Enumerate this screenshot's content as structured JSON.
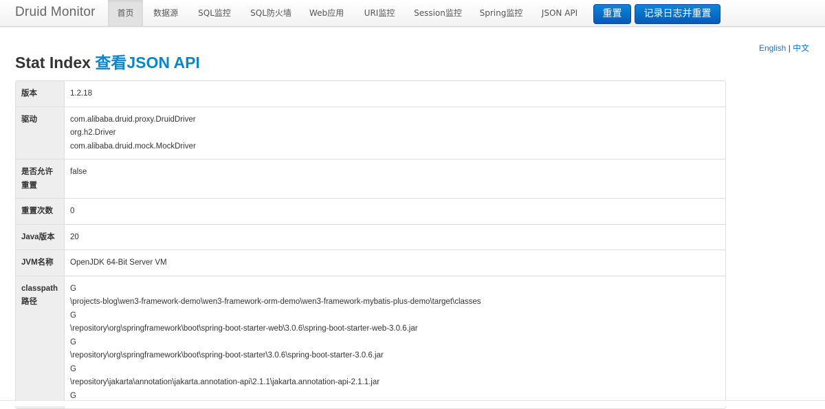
{
  "navbar": {
    "brand": "Druid Monitor",
    "items": [
      {
        "label": "首页",
        "active": true
      },
      {
        "label": "数据源"
      },
      {
        "label": "SQL监控"
      },
      {
        "label": "SQL防火墙"
      },
      {
        "label": "Web应用"
      },
      {
        "label": "URI监控"
      },
      {
        "label": "Session监控"
      },
      {
        "label": "Spring监控"
      },
      {
        "label": "JSON API"
      }
    ],
    "reset_button": "重置",
    "log_reset_button": "记录日志并重置",
    "button_color": "#0a6fcd"
  },
  "lang": {
    "english": "English",
    "separator": "|",
    "chinese": "中文"
  },
  "page": {
    "title": "Stat Index",
    "json_api_link": "查看JSON API"
  },
  "stats": [
    {
      "label": "版本",
      "lines": [
        "1.2.18"
      ]
    },
    {
      "label": "驱动",
      "lines": [
        "com.alibaba.druid.proxy.DruidDriver",
        "org.h2.Driver",
        "com.alibaba.druid.mock.MockDriver"
      ]
    },
    {
      "label": "是否允许重置",
      "lines": [
        "false"
      ]
    },
    {
      "label": "重置次数",
      "lines": [
        "0"
      ]
    },
    {
      "label": "Java版本",
      "lines": [
        "20"
      ]
    },
    {
      "label": "JVM名称",
      "lines": [
        "OpenJDK 64-Bit Server VM"
      ]
    },
    {
      "label": "classpath路径",
      "lines": [
        "G",
        "\\projects-blog\\wen3-framework-demo\\wen3-framework-orm-demo\\wen3-framework-mybatis-plus-demo\\target\\classes",
        "G",
        "\\repository\\org\\springframework\\boot\\spring-boot-starter-web\\3.0.6\\spring-boot-starter-web-3.0.6.jar",
        "G",
        "\\repository\\org\\springframework\\boot\\spring-boot-starter\\3.0.6\\spring-boot-starter-3.0.6.jar",
        "G",
        "\\repository\\jakarta\\annotation\\jakarta.annotation-api\\2.1.1\\jakarta.annotation-api-2.1.1.jar",
        "G"
      ]
    }
  ]
}
